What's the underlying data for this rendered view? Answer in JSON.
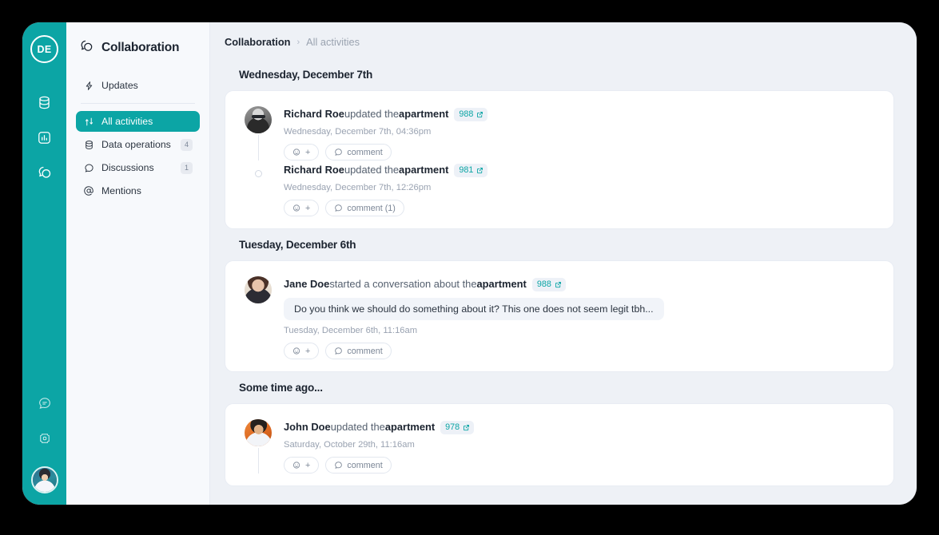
{
  "rail": {
    "logo_label": "DE",
    "icons": [
      {
        "name": "database-icon"
      },
      {
        "name": "analytics-icon"
      },
      {
        "name": "collaboration-icon"
      }
    ],
    "bottom_icons": [
      {
        "name": "help-chat-icon"
      },
      {
        "name": "apps-icon"
      }
    ],
    "avatar_name": "current-user-avatar"
  },
  "sidebar": {
    "title": "Collaboration",
    "items": [
      {
        "label": "Updates",
        "icon": "lightning-icon",
        "badge": "",
        "active": false
      },
      {
        "label": "All activities",
        "icon": "activities-icon",
        "badge": "",
        "active": true
      },
      {
        "label": "Data operations",
        "icon": "database-icon",
        "badge": "4",
        "active": false
      },
      {
        "label": "Discussions",
        "icon": "chat-bubble-icon",
        "badge": "1",
        "active": false
      },
      {
        "label": "Mentions",
        "icon": "at-icon",
        "badge": "",
        "active": false
      }
    ]
  },
  "breadcrumb": {
    "root": "Collaboration",
    "separator": "›",
    "current": "All activities"
  },
  "actions": {
    "react_label": "+",
    "comment_label": "comment",
    "comment_label_one": "comment (1)"
  },
  "feed": [
    {
      "heading": "Wednesday, December 7th",
      "entries": [
        {
          "avatar": "ph-richard",
          "who": "Richard Roe",
          "verb": " updated the ",
          "object": "apartment",
          "ref": "988",
          "quote": "",
          "timestamp": "Wednesday, December 7th, 04:36pm",
          "comment_label": "comment",
          "rail": "line"
        },
        {
          "avatar": "",
          "who": "Richard Roe",
          "verb": " updated the ",
          "object": "apartment",
          "ref": "981",
          "quote": "",
          "timestamp": "Wednesday, December 7th, 12:26pm",
          "comment_label": "comment (1)",
          "rail": "dot"
        }
      ]
    },
    {
      "heading": "Tuesday, December 6th",
      "entries": [
        {
          "avatar": "ph-jane",
          "who": "Jane Doe",
          "verb": " started a conversation about the ",
          "object": "apartment",
          "ref": "988",
          "quote": "Do you think we should do something about it? This one does not seem legit tbh...",
          "timestamp": "Tuesday, December 6th, 11:16am",
          "comment_label": "comment",
          "rail": "none"
        }
      ]
    },
    {
      "heading": "Some time ago...",
      "entries": [
        {
          "avatar": "ph-john",
          "who": "John Doe",
          "verb": " updated the ",
          "object": "apartment",
          "ref": "978",
          "quote": "",
          "timestamp": "Saturday, October 29th, 11:16am",
          "comment_label": "comment",
          "rail": "line"
        }
      ]
    }
  ],
  "colors": {
    "accent": "#0ca5a5",
    "page_bg": "#eef1f6",
    "card_bg": "#ffffff",
    "text_primary": "#1c2430",
    "text_muted": "#99a2b1"
  }
}
